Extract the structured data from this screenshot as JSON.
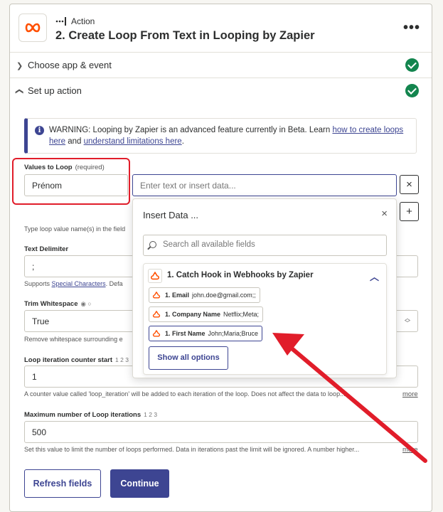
{
  "header": {
    "step_type": "Action",
    "step_title": "2. Create Loop From Text in Looping by Zapier",
    "more_glyph": "•••"
  },
  "sections": {
    "choose_app": "Choose app & event",
    "set_up": "Set up action"
  },
  "warning": {
    "prefix": "WARNING: Looping by Zapier is an advanced feature currently in Beta. Learn ",
    "link1": "how to create loops here",
    "middle": " and ",
    "link2": "understand limitations here",
    "suffix": "."
  },
  "values_to_loop": {
    "label": "Values to Loop",
    "required": "(required)",
    "key_value": "Prénom",
    "value_placeholder": "Enter text or insert data...",
    "help": "Type loop value name(s) in the field",
    "remove_glyph": "×",
    "add_glyph": "+"
  },
  "text_delimiter": {
    "label": "Text Delimiter",
    "value": ";",
    "help_prefix": "Supports ",
    "help_link": "Special Characters",
    "help_suffix": ". Defa"
  },
  "trim_whitespace": {
    "label": "Trim Whitespace",
    "indicator": "◉ ○",
    "value": "True",
    "help": "Remove whitespace surrounding e"
  },
  "counter_start": {
    "label": "Loop iteration counter start",
    "hint": "1 2 3",
    "value": "1",
    "help": "A counter value called 'loop_iteration' will be added to each iteration of the loop. Does not affect the data to loop...",
    "more": "more"
  },
  "max_iterations": {
    "label": "Maximum number of Loop iterations",
    "hint": "1 2 3",
    "value": "500",
    "help": "Set this value to limit the number of loops performed. Data in iterations past the limit will be ignored. A number higher...",
    "more": "more"
  },
  "buttons": {
    "refresh": "Refresh fields",
    "continue": "Continue"
  },
  "insert_data": {
    "title": "Insert Data ...",
    "close_glyph": "×",
    "search_placeholder": "Search all available fields",
    "source_title": "1. Catch Hook in Webhooks by Zapier",
    "fields": [
      {
        "name": "1. Email",
        "value": "john.doe@gmail.com;;"
      },
      {
        "name": "1. Company Name",
        "value": "Netflix;Meta;"
      },
      {
        "name": "1. First Name",
        "value": "John;Maria;Bruce"
      }
    ],
    "show_all": "Show all options"
  },
  "colors": {
    "accent": "#3d4592",
    "success": "#13854e",
    "zapier_orange": "#ff4f00",
    "annotation_red": "#e11d2a"
  }
}
